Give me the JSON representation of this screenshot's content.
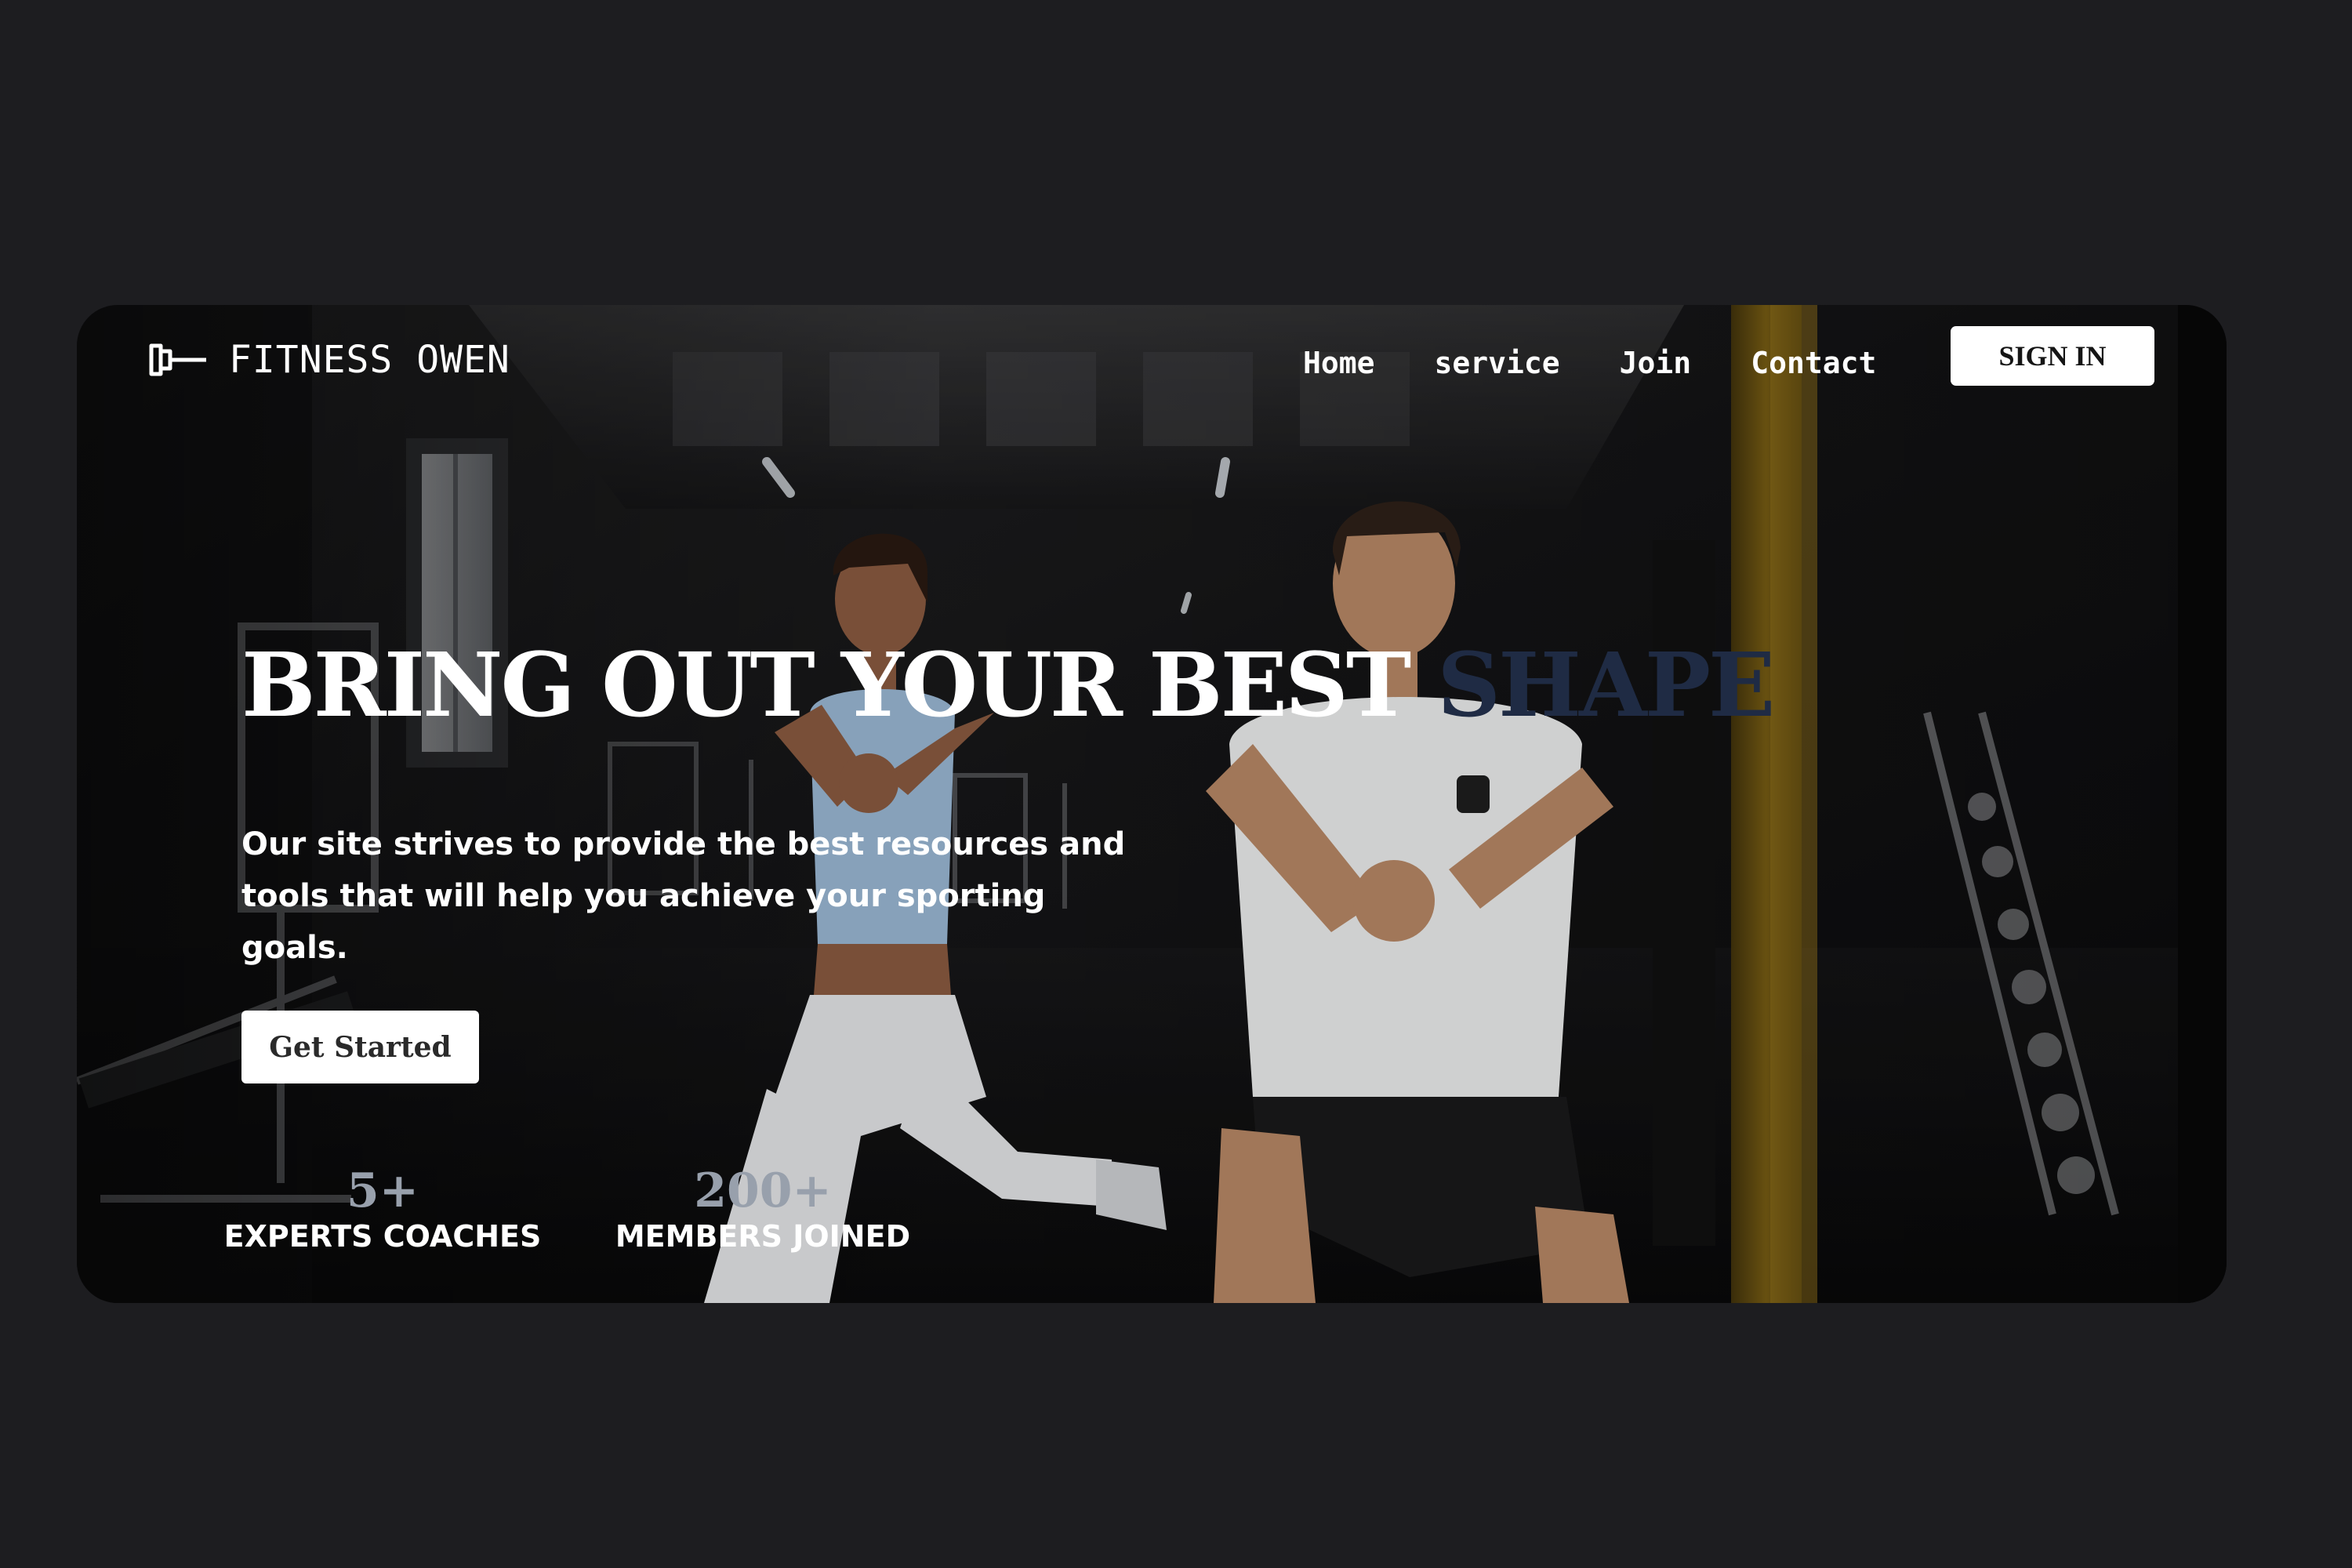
{
  "brand": {
    "name": "FITNESS OWEN",
    "icon": "dumbbell-icon"
  },
  "nav": {
    "links": [
      "Home",
      "service",
      "Join",
      "Contact"
    ],
    "signin_label": "SIGN IN"
  },
  "hero": {
    "headline_main": "BRING OUT YOUR BEST ",
    "headline_accent": "SHAPE",
    "subtitle": "Our site strives to provide the best resources and tools that will help you achieve your sporting goals.",
    "cta_label": "Get Started",
    "background": "gym-photo-two-people-doing-lunges"
  },
  "stats": [
    {
      "value": "5+",
      "label": "EXPERTS COACHES"
    },
    {
      "value": "200+",
      "label": "MEMBERS JOINED"
    }
  ],
  "colors": {
    "page_background": "#1d1d20",
    "headline_accent": "#1f2b44",
    "stat_value": "#98a0ac",
    "button_background": "#ffffff"
  }
}
